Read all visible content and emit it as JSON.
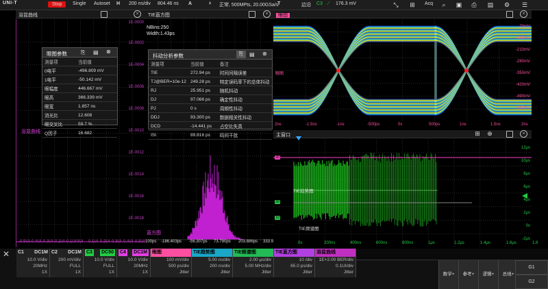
{
  "topbar": {
    "logo": "UNI-T",
    "run": "Stop",
    "single": "Single",
    "autoset": "Autoset",
    "h": "H",
    "timebase": "200 ns/div",
    "delay": "804.46 ns",
    "a": "A",
    "status": "正常, 500MPts, 20.00GSa/s",
    "t": "T",
    "trig_mode": "边沿",
    "trig_ch": "C3",
    "trig_level": "176.3 mV",
    "acq": "Acq"
  },
  "bathtub": {
    "title": "浴盆曲线",
    "label": "浴盆曲线",
    "yticks": [
      "1E-0000",
      "1E-0002",
      "1E-0004",
      "1E-0006",
      "1E-0008",
      "1E-0010",
      "1E-0012",
      "1E-0014",
      "1E-0016",
      "1E-0018"
    ],
    "xticks": [
      "-0.5UI",
      "-0.4UI",
      "-0.3UI",
      "-0.2UI",
      "-0.1UI",
      "0UI",
      "0.1UI",
      "0.2UI",
      "0.3UI",
      "0.4UI",
      "0.5UI"
    ],
    "left_tick": "0UI"
  },
  "eye_table": {
    "title": "眼图参数",
    "rows": [
      [
        "测量项",
        "当前值"
      ],
      [
        "0电平",
        "-496.809 mV"
      ],
      [
        "1电平",
        "-50.142 mV"
      ],
      [
        "眼幅度",
        "446.667 mV"
      ],
      [
        "眼高",
        "366.339 mV"
      ],
      [
        "眼宽",
        "1.857 ns"
      ],
      [
        "消光比",
        "12.608"
      ],
      [
        "眼交叉比",
        "59.7 %"
      ],
      [
        "Q因子",
        "16.682"
      ]
    ]
  },
  "tie": {
    "title": "TIE直方图",
    "nbins": "NBins:250",
    "width": "Width:1.43ps",
    "label": "直方图",
    "xticks": [
      "100ps",
      "-186.403ps",
      "-56.307ps",
      "73.790ps",
      "203.886ps",
      "333.9"
    ]
  },
  "jitter_table": {
    "title": "抖动分析参数",
    "rows": [
      [
        "测量项",
        "当前值",
        "备注"
      ],
      [
        "TIE",
        "272.94 ps",
        "时间间隔误差"
      ],
      [
        "TJ@BER=10e-12",
        "249.28 ps",
        "特定误码率下的总体抖动"
      ],
      [
        "RJ",
        "25.951 ps",
        "随机抖动"
      ],
      [
        "DJ",
        "97.066 ps",
        "确定性抖动"
      ],
      [
        "PJ",
        "0 s",
        "周期性抖动"
      ],
      [
        "DDJ",
        "93.300 ps",
        "数据相关性抖动"
      ],
      [
        "DCD",
        "-14.441 ps",
        "占空比失真"
      ],
      [
        "ISI",
        "89.816 ps",
        "码间干扰"
      ]
    ]
  },
  "eye": {
    "title": "眼图",
    "label": "眼图",
    "yticks": [
      "-70mV",
      "-140mV",
      "-210mV",
      "-280mV",
      "-350mV",
      "-420mV",
      "-490mV",
      "-560mV"
    ],
    "xticks": [
      "2ns",
      "-1.5ns",
      "-1ns",
      "-500ps",
      "0s",
      "500ps",
      "1ns",
      "1.5ns",
      "2ns"
    ]
  },
  "main": {
    "title": "主窗口",
    "trend_label": "TIE趋势图",
    "spectrum_label": "TIE频谱图",
    "yticks": [
      "12μs",
      "10μs",
      "8μs",
      "6μs",
      "4μs",
      "2μs",
      "0s",
      "-2μs"
    ],
    "xticks": [
      "0s",
      "200ns",
      "400ns",
      "600ns",
      "800ns",
      "1μs",
      "1.2μs",
      "1.4μs",
      "1.6μs",
      "1.8"
    ],
    "ch_top": "30",
    "ch_mid": "20",
    "ch_low": "10"
  },
  "channels": [
    {
      "name": "C1",
      "coupling": "DC1M",
      "l1": "10.0 V/div",
      "l2": "20MHz",
      "l3": "1X",
      "color": "#c0c0c0"
    },
    {
      "name": "C2",
      "coupling": "DC1M",
      "l1": "200 mV/div",
      "l2": "FULL",
      "l3": "1X",
      "color": "#c0c0c0"
    },
    {
      "name": "C3",
      "coupling": "DC50",
      "l1": "10.0 V/div",
      "l2": "FULL",
      "l3": "1X",
      "color": "#22cc44"
    },
    {
      "name": "C4",
      "coupling": "DC1M",
      "l1": "10.0 V/div",
      "l2": "20MHz",
      "l3": "1X",
      "color": "#e040e0"
    }
  ],
  "analysis": [
    {
      "name": "眼图",
      "l1": "100 mV/div",
      "l2": "500 ps/div",
      "l3": "Jitter",
      "color": "#ff4fa0"
    },
    {
      "name": "TIE趋势图",
      "l1": "5.00 ns/div",
      "l2": "200 ns/div",
      "l3": "Jitter",
      "color": "#1aa7c7"
    },
    {
      "name": "TIE频谱图",
      "l1": "2.00 μs/div",
      "l2": "5.00 MHz/div",
      "l3": "Jitter",
      "color": "#22bb55"
    },
    {
      "name": "TIE直方图",
      "l1": "10 /div",
      "l2": "65.0 ps/div",
      "l3": "Jitter",
      "color": "#b040e0"
    },
    {
      "name": "浴盆曲线",
      "l1": "1E+2.00 BER/div",
      "l2": "0.1UI/div",
      "l3": "Jitter",
      "color": "#c030c0"
    }
  ],
  "buttons": {
    "math": "数学+",
    "ref": "参考+",
    "logic": "逻辑+",
    "bus": "总线+",
    "g1": "G1",
    "g2": "G2"
  },
  "colors": {
    "eye_hot": "#ffff00",
    "trend": "#22dd22",
    "hist": "#c020d0",
    "ref": "#ff40c0"
  }
}
